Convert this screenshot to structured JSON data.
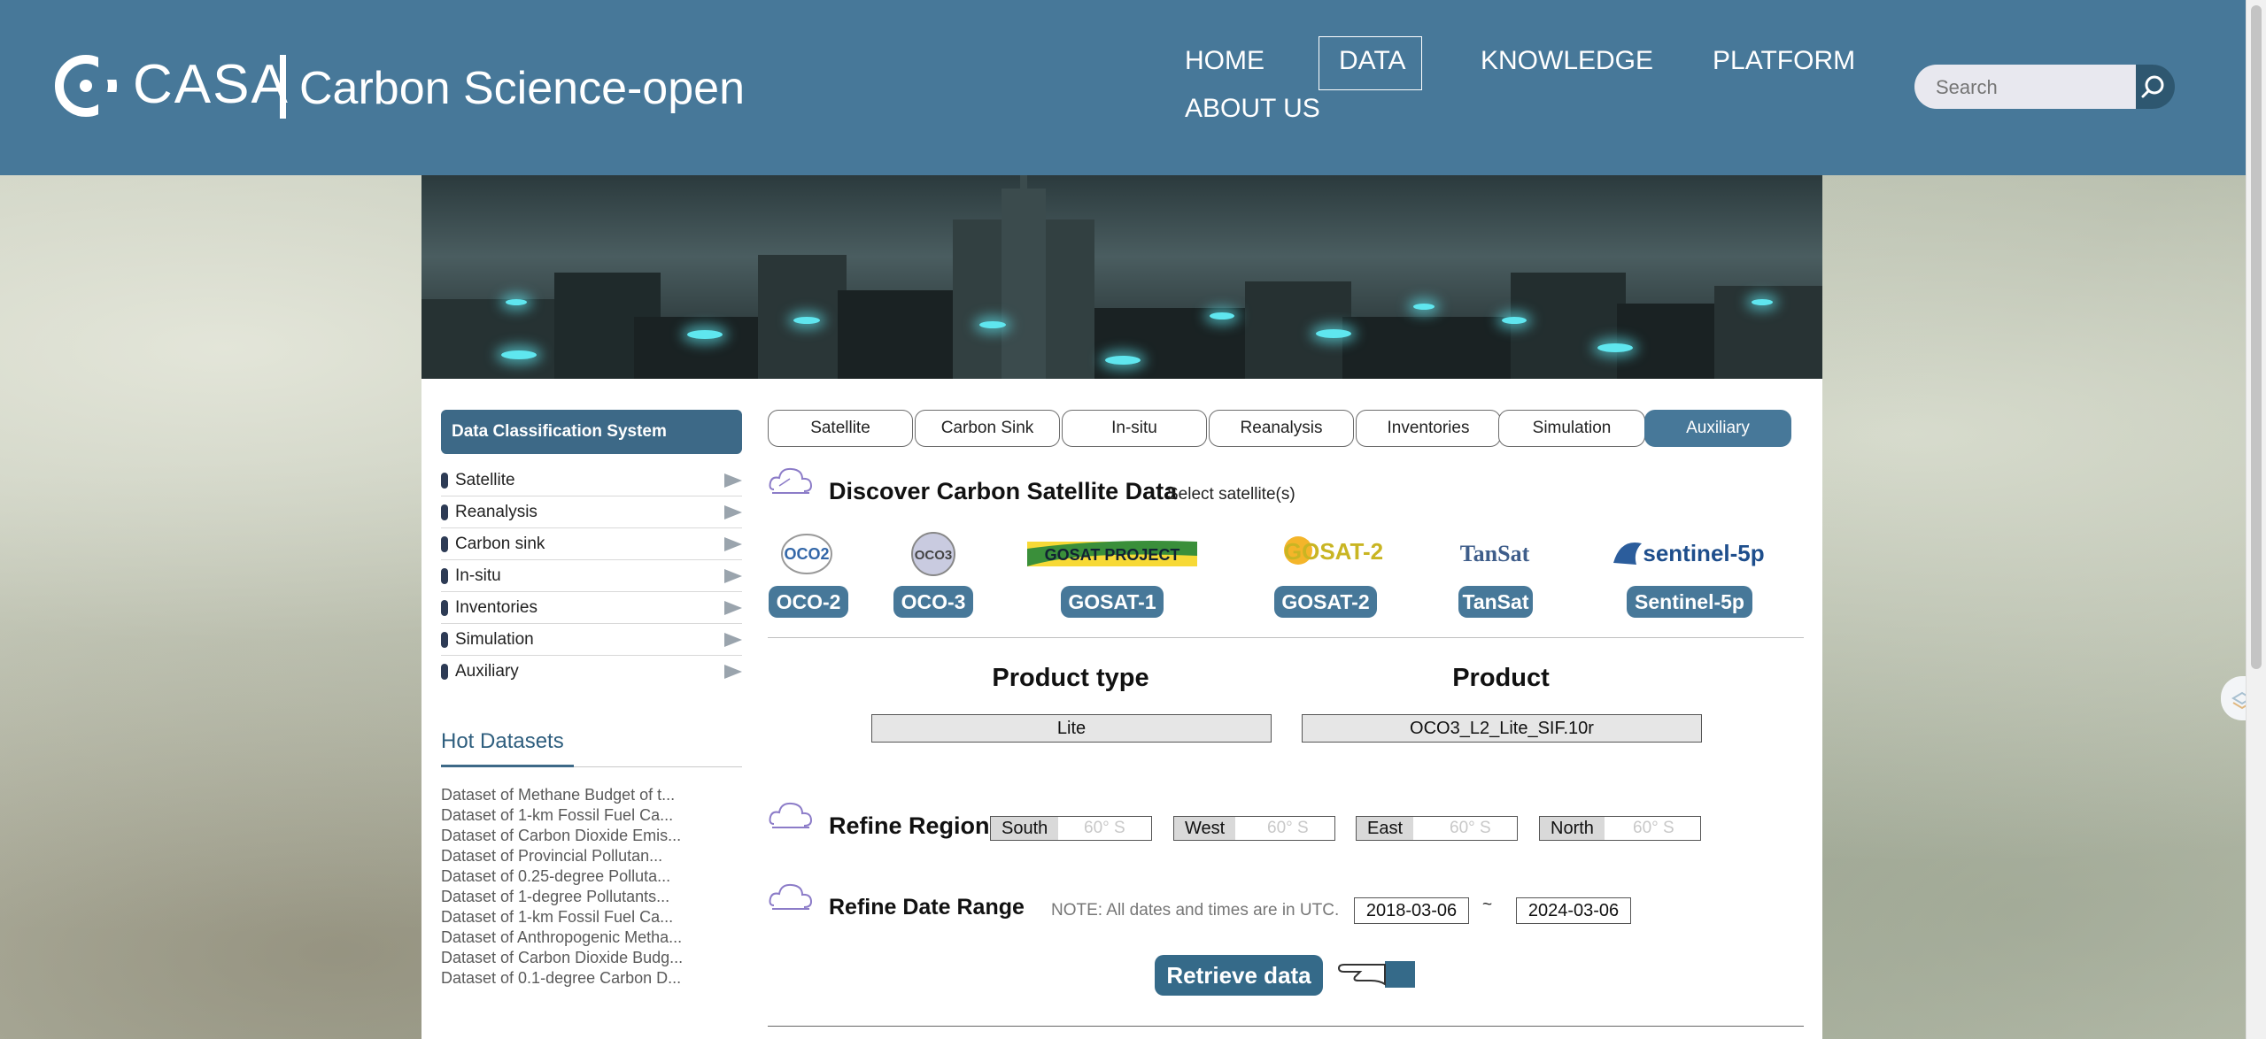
{
  "header": {
    "logo_text": "CASA",
    "logo_subtitle": "Carbon Science-open",
    "nav": [
      {
        "label": "HOME"
      },
      {
        "label": "DATA",
        "active": true
      },
      {
        "label": "KNOWLEDGE"
      },
      {
        "label": "PLATFORM"
      },
      {
        "label": "ABOUT US"
      }
    ],
    "search_placeholder": "Search"
  },
  "sidebar": {
    "title": "Data Classification System",
    "items": [
      {
        "label": "Satellite"
      },
      {
        "label": "Reanalysis"
      },
      {
        "label": "Carbon sink"
      },
      {
        "label": "In-situ"
      },
      {
        "label": "Inventories"
      },
      {
        "label": "Simulation"
      },
      {
        "label": "Auxiliary"
      }
    ],
    "hot_title": "Hot Datasets",
    "hot_items": [
      "Dataset of Methane Budget of t...",
      "Dataset of 1-km Fossil Fuel Ca...",
      "Dataset of Carbon Dioxide Emis...",
      "Dataset of Provincial Pollutan...",
      "Dataset of 0.25-degree Polluta...",
      "Dataset of 1-degree Pollutants...",
      "Dataset of 1-km Fossil Fuel Ca...",
      "Dataset of Anthropogenic Metha...",
      "Dataset of Carbon Dioxide Budg...",
      "Dataset of 0.1-degree Carbon D..."
    ]
  },
  "tabs": [
    "Satellite",
    "Carbon Sink",
    "In-situ",
    "Reanalysis",
    "Inventories",
    "Simulation",
    "Auxiliary"
  ],
  "active_tab": "Auxiliary",
  "discover": {
    "title": "Discover Carbon Satellite Data",
    "subtitle": "Select satellite(s)",
    "satellites": [
      {
        "label": "OCO-2",
        "logo_text": "OCO2"
      },
      {
        "label": "OCO-3",
        "logo_text": "OCO3"
      },
      {
        "label": "GOSAT-1",
        "logo_text": "GOSAT PROJECT"
      },
      {
        "label": "GOSAT-2",
        "logo_text": "GOSAT-2"
      },
      {
        "label": "TanSat",
        "logo_text": "TanSat"
      },
      {
        "label": "Sentinel-5p",
        "logo_text": "sentinel-5p"
      }
    ]
  },
  "product": {
    "type_heading": "Product type",
    "product_heading": "Product",
    "type_value": "Lite",
    "product_value": "OCO3_L2_Lite_SIF.10r"
  },
  "region": {
    "title": "Refine Region",
    "fields": [
      {
        "label": "South",
        "placeholder": "60° S"
      },
      {
        "label": "West",
        "placeholder": "60° S"
      },
      {
        "label": "East",
        "placeholder": "60° S"
      },
      {
        "label": "North",
        "placeholder": "60° S"
      }
    ]
  },
  "date_range": {
    "title": "Refine Date Range",
    "note": "NOTE: All dates and times are in UTC.",
    "start": "2018-03-06",
    "separator": "~",
    "end": "2024-03-06"
  },
  "retrieve_label": "Retrieve data",
  "colors": {
    "header": "#477899",
    "accent": "#3d6987",
    "button": "#356a89"
  }
}
